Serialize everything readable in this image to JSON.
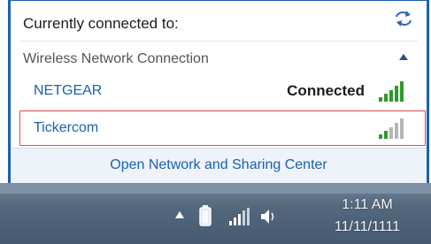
{
  "popup": {
    "header": "Currently connected to:",
    "refresh_icon": "refresh-arrows-icon",
    "section_label": "Wireless Network Connection",
    "collapse_icon": "chevron-up-icon",
    "networks": [
      {
        "name": "NETGEAR",
        "status": "Connected",
        "signal_bars": 5,
        "signal_level": 5
      },
      {
        "name": "Tickercom",
        "status": "",
        "signal_bars": 5,
        "signal_level": 2,
        "highlighted": true
      }
    ],
    "footer_link": "Open Network and Sharing Center"
  },
  "taskbar": {
    "tray_icons": [
      "show-hidden-icons-arrow",
      "battery-icon",
      "network-signal-icon",
      "speaker-icon"
    ],
    "time": "1:11 AM",
    "date": "11/11/1111"
  },
  "colors": {
    "link": "#1a5fb4",
    "signal_active": "#2e9a2e",
    "signal_inactive": "#b5b5b5",
    "highlight_border": "#e64a4a",
    "panel_border": "#1b5fb7"
  }
}
